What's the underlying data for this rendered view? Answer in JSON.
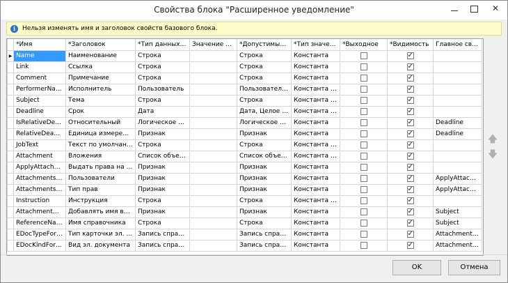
{
  "window": {
    "title": "Свойства блока \"Расширенное уведомление\"",
    "minimize": "–",
    "maximize": "□",
    "close": "✕"
  },
  "info": {
    "icon": "info-icon",
    "text": "Нельзя изменять имя и заголовок свойств базового блока."
  },
  "grid": {
    "columns": [
      "*Имя",
      "*Заголовок",
      "*Тип данных по ...",
      "Значение по ...",
      "*Допустимые ти...",
      "*Тип значения",
      "*Выходное",
      "*Видимость",
      "Главное свой..."
    ],
    "rows": [
      {
        "name": "Name",
        "title": "Наименование",
        "dtype": "Строка",
        "default": "",
        "allowed": "Строка",
        "vtype": "Константа",
        "output": false,
        "visible": true,
        "main": ""
      },
      {
        "name": "Link",
        "title": "Ссылка",
        "dtype": "Строка",
        "default": "",
        "allowed": "Строка",
        "vtype": "Константа",
        "output": false,
        "visible": true,
        "main": ""
      },
      {
        "name": "Comment",
        "title": "Примечание",
        "dtype": "Строка",
        "default": "",
        "allowed": "Строка",
        "vtype": "Константа",
        "output": false,
        "visible": true,
        "main": ""
      },
      {
        "name": "PerformerName",
        "title": "Исполнитель",
        "dtype": "Пользователь",
        "default": "",
        "allowed": "Пользователь, Г...",
        "vtype": "Константа или...",
        "output": false,
        "visible": true,
        "main": ""
      },
      {
        "name": "Subject",
        "title": "Тема",
        "dtype": "Строка",
        "default": "",
        "allowed": "Строка",
        "vtype": "Константа или...",
        "output": false,
        "visible": true,
        "main": ""
      },
      {
        "name": "Deadline",
        "title": "Срок",
        "dtype": "Дата",
        "default": "",
        "allowed": "Дата, Целое чис...",
        "vtype": "Константа или...",
        "output": false,
        "visible": true,
        "main": ""
      },
      {
        "name": "IsRelativeDeadline",
        "title": "Относительный",
        "dtype": "Логическое зна...",
        "default": "",
        "allowed": "Логическое зна...",
        "vtype": "Константа",
        "output": false,
        "visible": true,
        "main": "Deadline"
      },
      {
        "name": "RelativeDeadline...",
        "title": "Единица измерения",
        "dtype": "Признак",
        "default": "",
        "allowed": "Признак",
        "vtype": "Константа",
        "output": false,
        "visible": true,
        "main": "Deadline"
      },
      {
        "name": "JobText",
        "title": "Текст по умолчанию",
        "dtype": "Строка",
        "default": "",
        "allowed": "Строка",
        "vtype": "Константа или...",
        "output": false,
        "visible": true,
        "main": ""
      },
      {
        "name": "Attachment",
        "title": "Вложения",
        "dtype": "Список объектов",
        "default": "",
        "allowed": "Список объекто...",
        "vtype": "Константа или...",
        "output": false,
        "visible": true,
        "main": ""
      },
      {
        "name": "ApplyAttachme...",
        "title": "Выдать права на вло...",
        "dtype": "Признак",
        "default": "",
        "allowed": "Признак",
        "vtype": "Константа",
        "output": false,
        "visible": true,
        "main": ""
      },
      {
        "name": "AttachmentsRig...",
        "title": "Пользователи",
        "dtype": "Признак",
        "default": "",
        "allowed": "Признак",
        "vtype": "Константа",
        "output": false,
        "visible": true,
        "main": "ApplyAttachm..."
      },
      {
        "name": "AttachmentsRig...",
        "title": "Тип прав",
        "dtype": "Признак",
        "default": "",
        "allowed": "Признак",
        "vtype": "Константа",
        "output": false,
        "visible": true,
        "main": "ApplyAttachm..."
      },
      {
        "name": "Instruction",
        "title": "Инструкция",
        "dtype": "Строка",
        "default": "",
        "allowed": "Строка",
        "vtype": "Константа или...",
        "output": false,
        "visible": true,
        "main": ""
      },
      {
        "name": "AttachmentNa...",
        "title": "Добавлять имя влож...",
        "dtype": "Признак",
        "default": "",
        "allowed": "Признак",
        "vtype": "Константа",
        "output": false,
        "visible": true,
        "main": "Subject"
      },
      {
        "name": "ReferenceName...",
        "title": "Имя справочника",
        "dtype": "Строка",
        "default": "",
        "allowed": "Строка",
        "vtype": "Константа",
        "output": false,
        "visible": true,
        "main": "Subject"
      },
      {
        "name": "EDocTypeForAtt...",
        "title": "Тип карточки эл. док...",
        "dtype": "Запись справоч...",
        "default": "",
        "allowed": "Запись справоч...",
        "vtype": "Константа",
        "output": false,
        "visible": true,
        "main": "AttachmentNa..."
      },
      {
        "name": "EDocKindForAtt...",
        "title": "Вид эл. документа",
        "dtype": "Запись справоч...",
        "default": "",
        "allowed": "Запись справоч...",
        "vtype": "Константа",
        "output": false,
        "visible": true,
        "main": "AttachmentNa..."
      }
    ]
  },
  "side": {
    "up_icon": "arrow-up-icon",
    "down_icon": "arrow-down-icon",
    "up_glyph": "🡅",
    "down_glyph": "🡇"
  },
  "buttons": {
    "ok": "OK",
    "cancel": "Отмена"
  },
  "colors": {
    "selection": "#3399ff",
    "info_bg": "#fdfcc8"
  }
}
